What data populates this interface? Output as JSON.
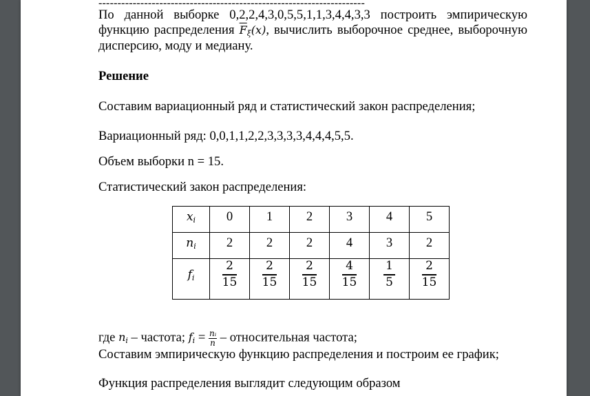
{
  "document": {
    "separator": "----------------------------------------------------------------------",
    "problem": {
      "line1": "По данной выборке 0,2,2,4,3,0,5,5,1,1,3,4,4,3,3 построить эмпирическую",
      "line2_before": "функцию распределения ",
      "line2_symbol": "F",
      "line2_symbol_sub": "ξ",
      "line2_symbol_arg": "(x)",
      "line2_after": ", вычислить выборочное среднее, выборочную",
      "line3": "дисперсию, моду и медиану."
    },
    "solution_heading": "Решение",
    "para_compose": "Составим вариационный ряд и статистический закон распределения;",
    "para_variation": "Вариационный ряд: 0,0,1,1,2,2,3,3,3,3,4,4,4,5,5.",
    "para_sample_size": "Объем выборки n = 15.",
    "para_stat_law": "Статистический закон распределения:",
    "table": {
      "row_headers": [
        {
          "symbol": "x",
          "sub": "i"
        },
        {
          "symbol": "n",
          "sub": "i"
        },
        {
          "symbol": "f",
          "sub": "i"
        }
      ],
      "x_values": [
        "0",
        "1",
        "2",
        "3",
        "4",
        "5"
      ],
      "n_values": [
        "2",
        "2",
        "2",
        "4",
        "3",
        "2"
      ],
      "f_values": [
        {
          "num": "2",
          "den": "15"
        },
        {
          "num": "2",
          "den": "15"
        },
        {
          "num": "2",
          "den": "15"
        },
        {
          "num": "4",
          "den": "15"
        },
        {
          "num": "1",
          "den": "5"
        },
        {
          "num": "2",
          "den": "15"
        }
      ]
    },
    "legend_line": {
      "prefix": "где ",
      "n_sym": "n",
      "n_sub": "i",
      "n_desc": " – частота; ",
      "f_sym": "f",
      "f_sub": "i",
      "equals": " = ",
      "frac_num": "nᵢ",
      "frac_den": "n",
      "f_desc": " – относительная частота;"
    },
    "para_build": "Составим эмпирическую функцию распределения и построим ее график;",
    "para_function": "Функция распределения выглядит следующим образом"
  }
}
